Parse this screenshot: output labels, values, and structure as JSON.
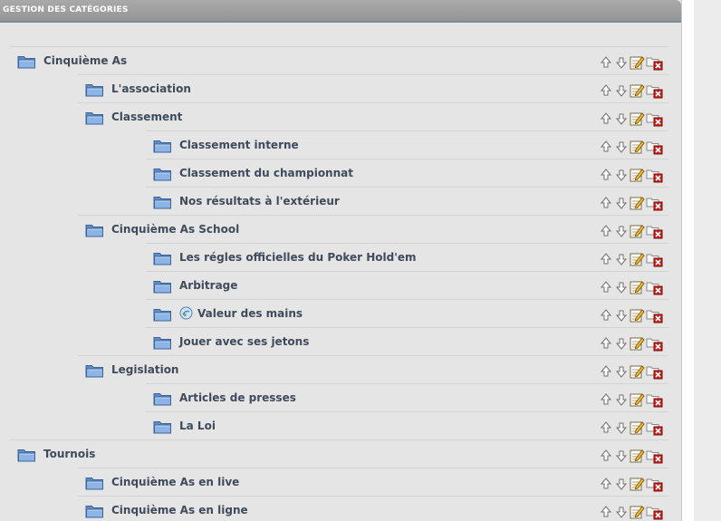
{
  "header": {
    "title": "GESTION DES CATÉGORIES"
  },
  "icons": {
    "folder": "folder-icon",
    "move_up": "arrow-up-icon",
    "move_down": "arrow-down-icon",
    "edit": "edit-pencil-icon",
    "delete": "delete-folder-icon",
    "badge": "globe-icon"
  },
  "colors": {
    "header_bg": "#a0a0a0",
    "panel_bg": "#e5e5e5",
    "label_text": "#3f4b5a",
    "folder_blue": "#6e9bd4",
    "delete_red": "#c8201a"
  },
  "categories": [
    {
      "label": "Cinquième As",
      "level": 0
    },
    {
      "label": "L'association",
      "level": 1
    },
    {
      "label": "Classement",
      "level": 1
    },
    {
      "label": "Classement interne",
      "level": 2
    },
    {
      "label": "Classement du championnat",
      "level": 2
    },
    {
      "label": "Nos résultats à l'extérieur",
      "level": 2
    },
    {
      "label": "Cinquième As School",
      "level": 1
    },
    {
      "label": "Les régles officielles du Poker Hold'em",
      "level": 2
    },
    {
      "label": "Arbitrage",
      "level": 2
    },
    {
      "label": "Valeur des mains",
      "level": 2,
      "badge": true
    },
    {
      "label": "Jouer avec ses jetons",
      "level": 2
    },
    {
      "label": "Legislation",
      "level": 1
    },
    {
      "label": "Articles de presses",
      "level": 2
    },
    {
      "label": "La Loi",
      "level": 2
    },
    {
      "label": "Tournois",
      "level": 0
    },
    {
      "label": "Cinquième As en live",
      "level": 1
    },
    {
      "label": "Cinquième As en ligne",
      "level": 1
    }
  ]
}
